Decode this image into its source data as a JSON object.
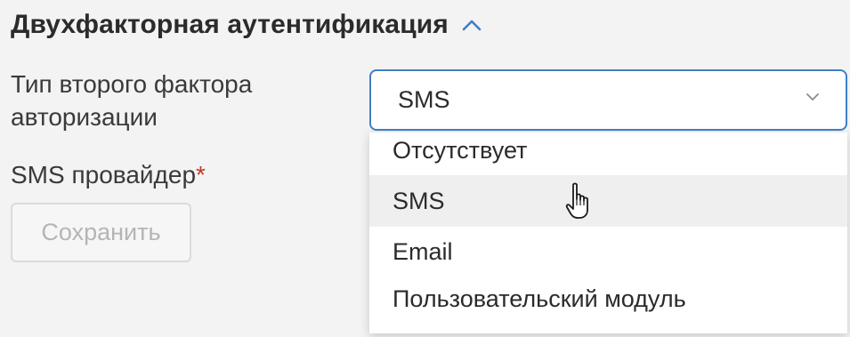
{
  "section": {
    "title": "Двухфакторная аутентификация",
    "toggle_icon": "chevron-up-icon"
  },
  "form": {
    "auth_type_label": "Тип второго фактора авторизации",
    "sms_provider_label": "SMS провайдер",
    "required_marker": "*",
    "auth_type_select": {
      "value": "SMS",
      "icon": "chevron-down-icon",
      "options": [
        "Отсутствует",
        "SMS",
        "Email",
        "Пользовательский модуль"
      ],
      "hovered_option": "SMS"
    },
    "save_button": {
      "label": "Сохранить",
      "disabled": true
    }
  },
  "colors": {
    "accent": "#3f7fc6",
    "required": "#c0392b",
    "text": "#2b2b2b",
    "disabled_text": "#b5b5b5",
    "hover_bg": "#efefef"
  },
  "cursor": "hand-pointer-icon"
}
